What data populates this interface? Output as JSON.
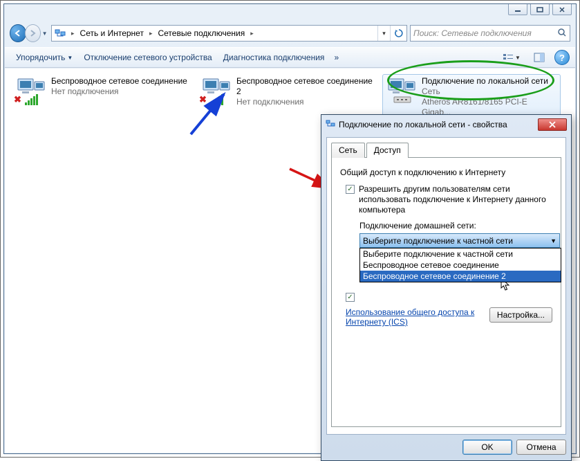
{
  "breadcrumb": {
    "seg1": "Сеть и Интернет",
    "seg2": "Сетевые подключения"
  },
  "search": {
    "placeholder": "Поиск: Сетевые подключения"
  },
  "toolbar": {
    "organize": "Упорядочить",
    "disable": "Отключение сетевого устройства",
    "diagnose": "Диагностика подключения"
  },
  "connections": [
    {
      "name": "Беспроводное сетевое соединение",
      "status": "Нет подключения"
    },
    {
      "name": "Беспроводное сетевое соединение 2",
      "status": "Нет подключения"
    },
    {
      "name": "Подключение по локальной сети",
      "status": "Сеть",
      "device": "Atheros AR8161/8165 PCI-E Gigab..."
    }
  ],
  "dialog": {
    "title": "Подключение по локальной сети - свойства",
    "tabs": {
      "network": "Сеть",
      "sharing": "Доступ"
    },
    "section": "Общий доступ к подключению к Интернету",
    "chk1": "Разрешить другим пользователям сети использовать подключение к Интернету данного компьютера",
    "home_label": "Подключение домашней сети:",
    "combo_selected": "Выберите подключение к частной сети",
    "options": [
      "Выберите подключение к частной сети",
      "Беспроводное сетевое соединение",
      "Беспроводное сетевое соединение 2"
    ],
    "link": "Использование общего доступа к Интернету (ICS)",
    "settings_btn": "Настройка...",
    "ok": "OK",
    "cancel": "Отмена"
  }
}
